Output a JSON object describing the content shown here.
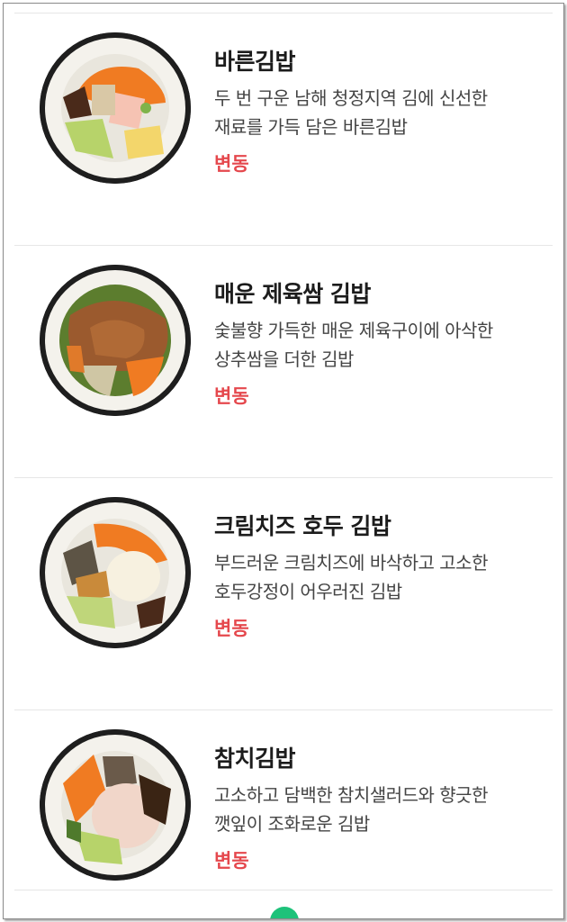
{
  "menu": {
    "items": [
      {
        "name": "바른김밥",
        "desc_line1": "두 번 구운 남해 청정지역 김에 신선한",
        "desc_line2": "재료를 가득 담은 바른김밥",
        "badge": "변동",
        "image": "kimbap-classic"
      },
      {
        "name": "매운 제육쌈 김밥",
        "desc_line1": "숯불향 가득한 매운 제육구이에 아삭한",
        "desc_line2": "상추쌈을 더한 김밥",
        "badge": "변동",
        "image": "kimbap-spicy-pork"
      },
      {
        "name": "크림치즈 호두 김밥",
        "desc_line1": "부드러운 크림치즈에 바삭하고 고소한",
        "desc_line2": "호두강정이 어우러진 김밥",
        "badge": "변동",
        "image": "kimbap-cream-cheese-walnut"
      },
      {
        "name": "참치김밥",
        "desc_line1": "고소하고 담백한 참치샐러드와 향긋한",
        "desc_line2": "깻잎이 조화로운 김밥",
        "badge": "변동",
        "image": "kimbap-tuna"
      }
    ]
  },
  "colors": {
    "badge": "#e5484d",
    "title": "#1c1c1c",
    "desc": "#444444",
    "divider": "#e6e6e6",
    "fab": "#1ec27a"
  }
}
